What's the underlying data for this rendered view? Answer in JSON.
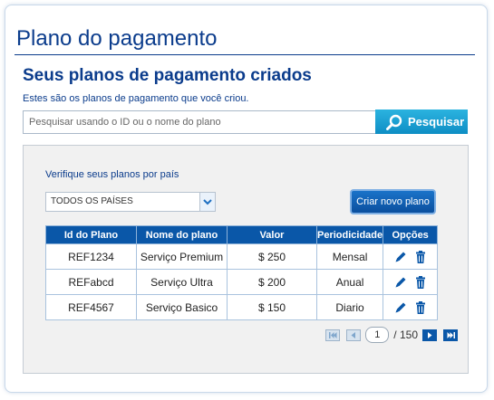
{
  "page": {
    "title": "Plano do pagamento",
    "subtitle": "Seus planos de pagamento criados",
    "intro": "Estes são os planos de pagamento que você criou."
  },
  "search": {
    "placeholder": "Pesquisar usando o ID ou o nome do plano",
    "button_label": "Pesquisar",
    "button_icon": "search-icon"
  },
  "filter": {
    "label": "Verifique seus planos por país",
    "selected": "TODOS OS PAÍSES"
  },
  "create_button": "Criar novo plano",
  "table": {
    "headers": [
      "Id do Plano",
      "Nome do plano",
      "Valor",
      "Periodicidade",
      "Opções"
    ],
    "rows": [
      {
        "id": "REF1234",
        "name": "Serviço Premium",
        "value": "$ 250",
        "period": "Mensal"
      },
      {
        "id": "REFabcd",
        "name": "Serviço Ultra",
        "value": "$ 200",
        "period": "Anual"
      },
      {
        "id": "REF4567",
        "name": "Serviço Basico",
        "value": "$ 150",
        "period": "Diario"
      }
    ],
    "option_icons": [
      "pencil-icon",
      "trash-icon"
    ]
  },
  "pagination": {
    "current": "1",
    "total": "/ 150"
  },
  "colors": {
    "brand_blue": "#0b3c8c",
    "header_blue": "#0a57a8",
    "search_button": "#1aa3d8"
  }
}
